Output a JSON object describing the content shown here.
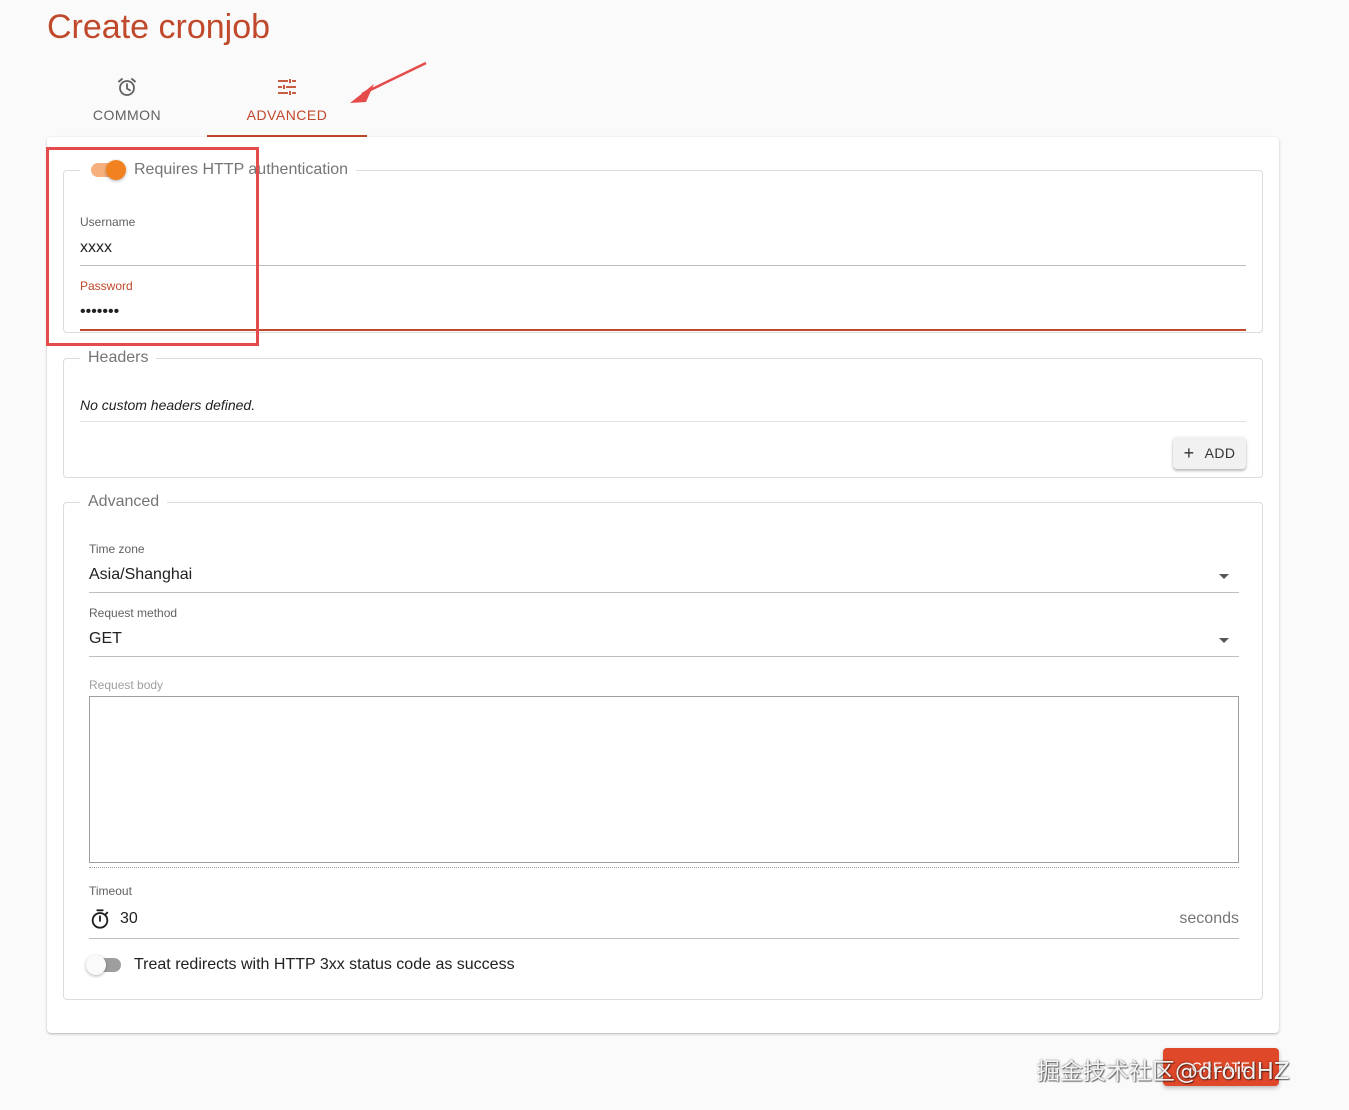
{
  "page": {
    "title": "Create cronjob"
  },
  "tabs": [
    {
      "label": "COMMON",
      "icon": "alarm-clock-icon",
      "active": false
    },
    {
      "label": "ADVANCED",
      "icon": "tune-sliders-icon",
      "active": true
    }
  ],
  "colors": {
    "accent": "#c0482b",
    "switch_on": "#f2811f",
    "create_button": "#e0482a",
    "annotation": "#e64b4b"
  },
  "auth": {
    "toggle_label": "Requires HTTP authentication",
    "enabled": true,
    "username": {
      "label": "Username",
      "value": "xxxx"
    },
    "password": {
      "label": "Password",
      "value": "•••••••"
    }
  },
  "headers": {
    "legend": "Headers",
    "empty_text": "No custom headers defined.",
    "add_label": "ADD"
  },
  "advanced": {
    "legend": "Advanced",
    "timezone": {
      "label": "Time zone",
      "value": "Asia/Shanghai"
    },
    "request_method": {
      "label": "Request method",
      "value": "GET"
    },
    "request_body": {
      "label": "Request body",
      "value": ""
    },
    "timeout": {
      "label": "Timeout",
      "value": "30",
      "unit": "seconds"
    },
    "redirect_toggle": {
      "label": "Treat redirects with HTTP 3xx status code as success",
      "enabled": false
    }
  },
  "footer": {
    "create_label": "CREATE"
  },
  "watermark": "掘金技术社区@droidHZ"
}
